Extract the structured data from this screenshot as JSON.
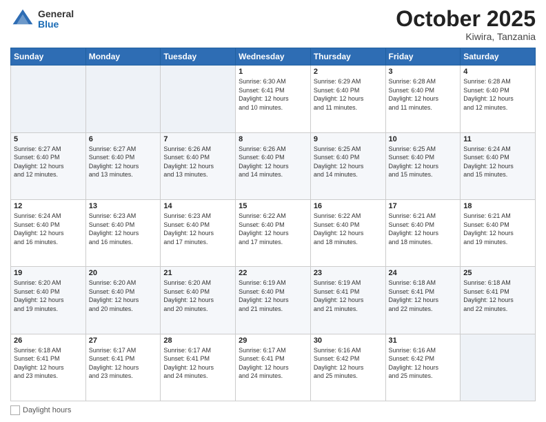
{
  "header": {
    "logo": {
      "general": "General",
      "blue": "Blue"
    },
    "title": "October 2025",
    "location": "Kiwira, Tanzania"
  },
  "days_of_week": [
    "Sunday",
    "Monday",
    "Tuesday",
    "Wednesday",
    "Thursday",
    "Friday",
    "Saturday"
  ],
  "weeks": [
    [
      {
        "day": "",
        "info": ""
      },
      {
        "day": "",
        "info": ""
      },
      {
        "day": "",
        "info": ""
      },
      {
        "day": "1",
        "info": "Sunrise: 6:30 AM\nSunset: 6:41 PM\nDaylight: 12 hours\nand 10 minutes."
      },
      {
        "day": "2",
        "info": "Sunrise: 6:29 AM\nSunset: 6:40 PM\nDaylight: 12 hours\nand 11 minutes."
      },
      {
        "day": "3",
        "info": "Sunrise: 6:28 AM\nSunset: 6:40 PM\nDaylight: 12 hours\nand 11 minutes."
      },
      {
        "day": "4",
        "info": "Sunrise: 6:28 AM\nSunset: 6:40 PM\nDaylight: 12 hours\nand 12 minutes."
      }
    ],
    [
      {
        "day": "5",
        "info": "Sunrise: 6:27 AM\nSunset: 6:40 PM\nDaylight: 12 hours\nand 12 minutes."
      },
      {
        "day": "6",
        "info": "Sunrise: 6:27 AM\nSunset: 6:40 PM\nDaylight: 12 hours\nand 13 minutes."
      },
      {
        "day": "7",
        "info": "Sunrise: 6:26 AM\nSunset: 6:40 PM\nDaylight: 12 hours\nand 13 minutes."
      },
      {
        "day": "8",
        "info": "Sunrise: 6:26 AM\nSunset: 6:40 PM\nDaylight: 12 hours\nand 14 minutes."
      },
      {
        "day": "9",
        "info": "Sunrise: 6:25 AM\nSunset: 6:40 PM\nDaylight: 12 hours\nand 14 minutes."
      },
      {
        "day": "10",
        "info": "Sunrise: 6:25 AM\nSunset: 6:40 PM\nDaylight: 12 hours\nand 15 minutes."
      },
      {
        "day": "11",
        "info": "Sunrise: 6:24 AM\nSunset: 6:40 PM\nDaylight: 12 hours\nand 15 minutes."
      }
    ],
    [
      {
        "day": "12",
        "info": "Sunrise: 6:24 AM\nSunset: 6:40 PM\nDaylight: 12 hours\nand 16 minutes."
      },
      {
        "day": "13",
        "info": "Sunrise: 6:23 AM\nSunset: 6:40 PM\nDaylight: 12 hours\nand 16 minutes."
      },
      {
        "day": "14",
        "info": "Sunrise: 6:23 AM\nSunset: 6:40 PM\nDaylight: 12 hours\nand 17 minutes."
      },
      {
        "day": "15",
        "info": "Sunrise: 6:22 AM\nSunset: 6:40 PM\nDaylight: 12 hours\nand 17 minutes."
      },
      {
        "day": "16",
        "info": "Sunrise: 6:22 AM\nSunset: 6:40 PM\nDaylight: 12 hours\nand 18 minutes."
      },
      {
        "day": "17",
        "info": "Sunrise: 6:21 AM\nSunset: 6:40 PM\nDaylight: 12 hours\nand 18 minutes."
      },
      {
        "day": "18",
        "info": "Sunrise: 6:21 AM\nSunset: 6:40 PM\nDaylight: 12 hours\nand 19 minutes."
      }
    ],
    [
      {
        "day": "19",
        "info": "Sunrise: 6:20 AM\nSunset: 6:40 PM\nDaylight: 12 hours\nand 19 minutes."
      },
      {
        "day": "20",
        "info": "Sunrise: 6:20 AM\nSunset: 6:40 PM\nDaylight: 12 hours\nand 20 minutes."
      },
      {
        "day": "21",
        "info": "Sunrise: 6:20 AM\nSunset: 6:40 PM\nDaylight: 12 hours\nand 20 minutes."
      },
      {
        "day": "22",
        "info": "Sunrise: 6:19 AM\nSunset: 6:40 PM\nDaylight: 12 hours\nand 21 minutes."
      },
      {
        "day": "23",
        "info": "Sunrise: 6:19 AM\nSunset: 6:41 PM\nDaylight: 12 hours\nand 21 minutes."
      },
      {
        "day": "24",
        "info": "Sunrise: 6:18 AM\nSunset: 6:41 PM\nDaylight: 12 hours\nand 22 minutes."
      },
      {
        "day": "25",
        "info": "Sunrise: 6:18 AM\nSunset: 6:41 PM\nDaylight: 12 hours\nand 22 minutes."
      }
    ],
    [
      {
        "day": "26",
        "info": "Sunrise: 6:18 AM\nSunset: 6:41 PM\nDaylight: 12 hours\nand 23 minutes."
      },
      {
        "day": "27",
        "info": "Sunrise: 6:17 AM\nSunset: 6:41 PM\nDaylight: 12 hours\nand 23 minutes."
      },
      {
        "day": "28",
        "info": "Sunrise: 6:17 AM\nSunset: 6:41 PM\nDaylight: 12 hours\nand 24 minutes."
      },
      {
        "day": "29",
        "info": "Sunrise: 6:17 AM\nSunset: 6:41 PM\nDaylight: 12 hours\nand 24 minutes."
      },
      {
        "day": "30",
        "info": "Sunrise: 6:16 AM\nSunset: 6:42 PM\nDaylight: 12 hours\nand 25 minutes."
      },
      {
        "day": "31",
        "info": "Sunrise: 6:16 AM\nSunset: 6:42 PM\nDaylight: 12 hours\nand 25 minutes."
      },
      {
        "day": "",
        "info": ""
      }
    ]
  ],
  "footer": {
    "legend_label": "Daylight hours"
  }
}
